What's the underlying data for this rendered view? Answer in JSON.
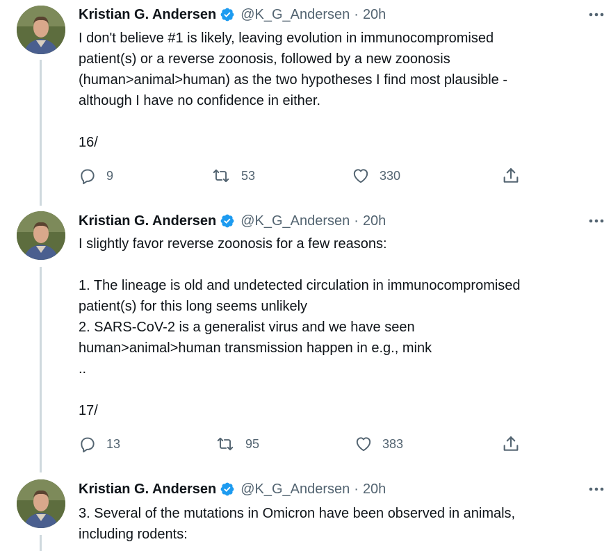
{
  "tweets": [
    {
      "name": "Kristian G. Andersen",
      "handle": "@K_G_Andersen",
      "separator": "·",
      "time": "20h",
      "lines": [
        "I don't believe #1 is likely, leaving evolution in immunocompromised",
        "patient(s) or a reverse zoonosis, followed by a new zoonosis",
        "(human>animal>human) as the two hypotheses I find most plausible -",
        "although I have no confidence in either.",
        "",
        "16/"
      ],
      "replies": "9",
      "retweets": "53",
      "likes": "330"
    },
    {
      "name": "Kristian G. Andersen",
      "handle": "@K_G_Andersen",
      "separator": "·",
      "time": "20h",
      "lines": [
        "I slightly favor reverse zoonosis for a few reasons:",
        "",
        "1. The lineage is old and undetected circulation in immunocompromised",
        "patient(s) for this long seems unlikely",
        "2. SARS-CoV-2 is a generalist virus and we have seen",
        "human>animal>human transmission happen in e.g., mink",
        "..",
        "",
        "17/"
      ],
      "replies": "13",
      "retweets": "95",
      "likes": "383"
    },
    {
      "name": "Kristian G. Andersen",
      "handle": "@K_G_Andersen",
      "separator": "·",
      "time": "20h",
      "lines": [
        "3. Several of the mutations in Omicron have been observed in animals,",
        "including rodents:"
      ]
    }
  ],
  "icons": {
    "verified": "verified-badge-icon",
    "more": "more-options-icon",
    "reply": "reply-icon",
    "retweet": "retweet-icon",
    "like": "like-icon",
    "share": "share-icon"
  },
  "colors": {
    "verified": "#1d9bf0",
    "secondary_text": "#536471",
    "thread_line": "#cfd9de"
  }
}
